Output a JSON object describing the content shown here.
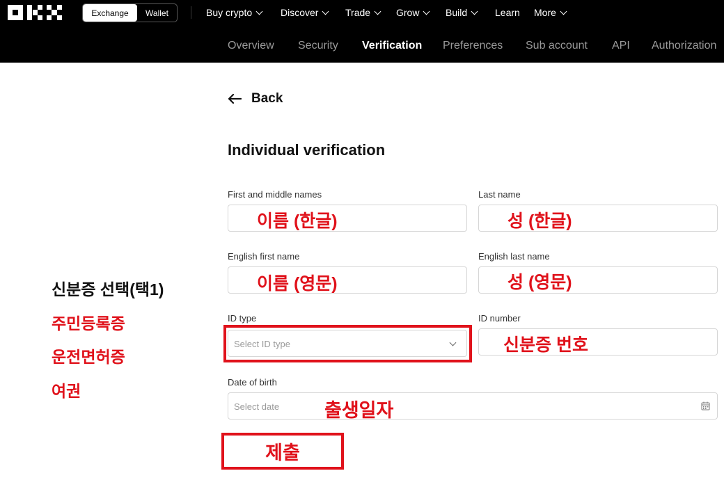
{
  "header": {
    "logo_text": "OKX",
    "mode_toggle": {
      "exchange": "Exchange",
      "wallet": "Wallet",
      "active": "Exchange"
    },
    "main_nav": [
      {
        "label": "Buy crypto",
        "dropdown": true
      },
      {
        "label": "Discover",
        "dropdown": true
      },
      {
        "label": "Trade",
        "dropdown": true
      },
      {
        "label": "Grow",
        "dropdown": true
      },
      {
        "label": "Build",
        "dropdown": true
      },
      {
        "label": "Learn",
        "dropdown": false
      },
      {
        "label": "More",
        "dropdown": true
      }
    ],
    "sub_nav": [
      "Overview",
      "Security",
      "Verification",
      "Preferences",
      "Sub account",
      "API",
      "Authorization"
    ],
    "sub_nav_active": "Verification"
  },
  "page": {
    "back_label": "Back",
    "title": "Individual verification"
  },
  "form": {
    "first_name": {
      "label": "First and middle names",
      "annotation": "이름 (한글)"
    },
    "last_name": {
      "label": "Last name",
      "annotation": "성 (한글)"
    },
    "english_first_name": {
      "label": "English first name",
      "annotation": "이름 (영문)"
    },
    "english_last_name": {
      "label": "English last name",
      "annotation": "성 (영문)"
    },
    "id_type": {
      "label": "ID type",
      "placeholder": "Select ID type"
    },
    "id_number": {
      "label": "ID number",
      "annotation": "신분증 번호"
    },
    "date_of_birth": {
      "label": "Date of birth",
      "placeholder": "Select date",
      "annotation": "출생일자"
    },
    "submit_annotation": "제출"
  },
  "side_notes": {
    "title": "신분증 선택(택1)",
    "options": [
      "주민등록증",
      "운전면허증",
      "여권"
    ]
  },
  "colors": {
    "annotation_red": "#e0121b",
    "header_bg": "#000000",
    "nav_inactive": "#9a9a9a"
  },
  "icons": [
    "okx-logo",
    "chevron-down-icon",
    "arrow-left-icon",
    "calendar-icon"
  ]
}
